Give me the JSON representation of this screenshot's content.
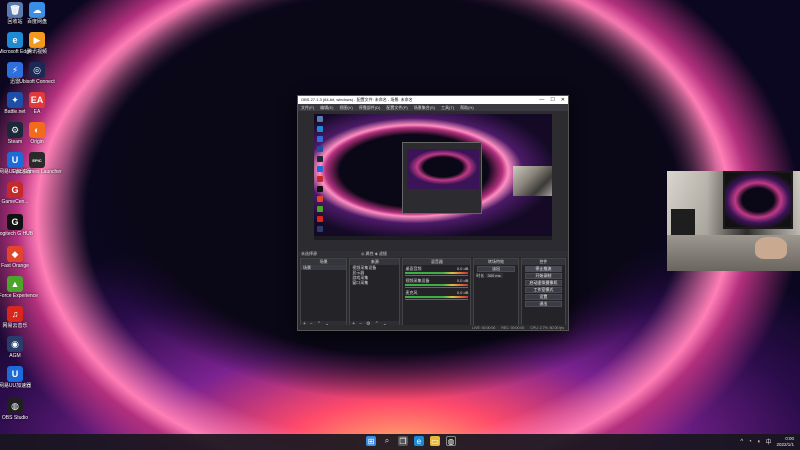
{
  "desktop": {
    "icons": [
      {
        "label": "回收站",
        "glyph": "🗑",
        "bg": "#5a7bb0"
      },
      {
        "label": "百度网盘",
        "glyph": "☁",
        "bg": "#3a8ee6"
      },
      {
        "label": "Microsoft Edge",
        "glyph": "e",
        "bg": "#1f8ad4"
      },
      {
        "label": "腾讯视频",
        "glyph": "▶",
        "bg": "#f39a1e"
      },
      {
        "label": "迅雷",
        "glyph": "⚡",
        "bg": "#2f6fdc"
      },
      {
        "label": "Ubisoft Connect",
        "glyph": "◎",
        "bg": "#1b2a54"
      },
      {
        "label": "Battle.net",
        "glyph": "✦",
        "bg": "#1e4fa8"
      },
      {
        "label": "EA",
        "glyph": "EA",
        "bg": "#e23a3a"
      },
      {
        "label": "Steam",
        "glyph": "⚙",
        "bg": "#1b2838"
      },
      {
        "label": "Origin",
        "glyph": "◐",
        "bg": "#f26a1b"
      },
      {
        "label": "网易UU加速器",
        "glyph": "U",
        "bg": "#1d6bd9"
      },
      {
        "label": "Epic Games Launcher",
        "glyph": "EPIC",
        "bg": "#2a2a2a"
      },
      {
        "label": "GameCen...",
        "glyph": "G",
        "bg": "#c52a2a"
      },
      {
        "label": "Logitech G HUB",
        "glyph": "G",
        "bg": "#111111"
      },
      {
        "label": "Fast Orange",
        "glyph": "◆",
        "bg": "#e2452a"
      },
      {
        "label": "GeForce Experience",
        "glyph": "▲",
        "bg": "#4aa52a"
      },
      {
        "label": "网易云音乐",
        "glyph": "♫",
        "bg": "#d8261d"
      },
      {
        "label": "AGM",
        "glyph": "◉",
        "bg": "#2a3c6a"
      },
      {
        "label": "网易UU加速器",
        "glyph": "U",
        "bg": "#1d6bd9"
      },
      {
        "label": "OBS Studio",
        "glyph": "◍",
        "bg": "#202020"
      }
    ]
  },
  "obs": {
    "title": "OBS 27.1.3 (64-bit, windows) - 配置文件: 未命名 - 场景: 未命名",
    "menu": [
      "文件(F)",
      "编辑(E)",
      "视图(V)",
      "停靠部件(D)",
      "配置文件(P)",
      "场景集合(S)",
      "工具(T)",
      "帮助(H)"
    ],
    "scenebar_left": "未选择源",
    "scenebar_right": "◎ 属性   ◈ 滤镜",
    "docks": {
      "scenes": {
        "title": "场景",
        "items": [
          "场景"
        ]
      },
      "sources": {
        "title": "来源",
        "items": [
          "视频采集设备",
          "显示器",
          "游戏采集",
          "窗口采集"
        ]
      },
      "mixer": {
        "title": "混音器",
        "channels": [
          {
            "name": "桌面音频",
            "level": "0.0 dB"
          },
          {
            "name": "视频采集设备",
            "level": "0.0 dB"
          },
          {
            "name": "麦克风",
            "level": "0.0 dB"
          }
        ]
      },
      "transitions": {
        "title": "转场特效",
        "type": "淡出",
        "duration_label": "时长",
        "duration": "300 ms"
      },
      "controls": {
        "title": "控件",
        "buttons": [
          "停止推流",
          "开始录制",
          "启动虚拟摄像机",
          "工作室模式",
          "设置",
          "退出"
        ]
      }
    },
    "status": [
      "LIVE: 00:00:00",
      "REC: 00:00:00",
      "CPU: 2.7%, 60.00 fps"
    ]
  },
  "taskbar": {
    "apps": [
      "start",
      "search",
      "task-view",
      "edge",
      "explorer",
      "obs"
    ],
    "time": "0:00",
    "date": "2022/1/1"
  }
}
